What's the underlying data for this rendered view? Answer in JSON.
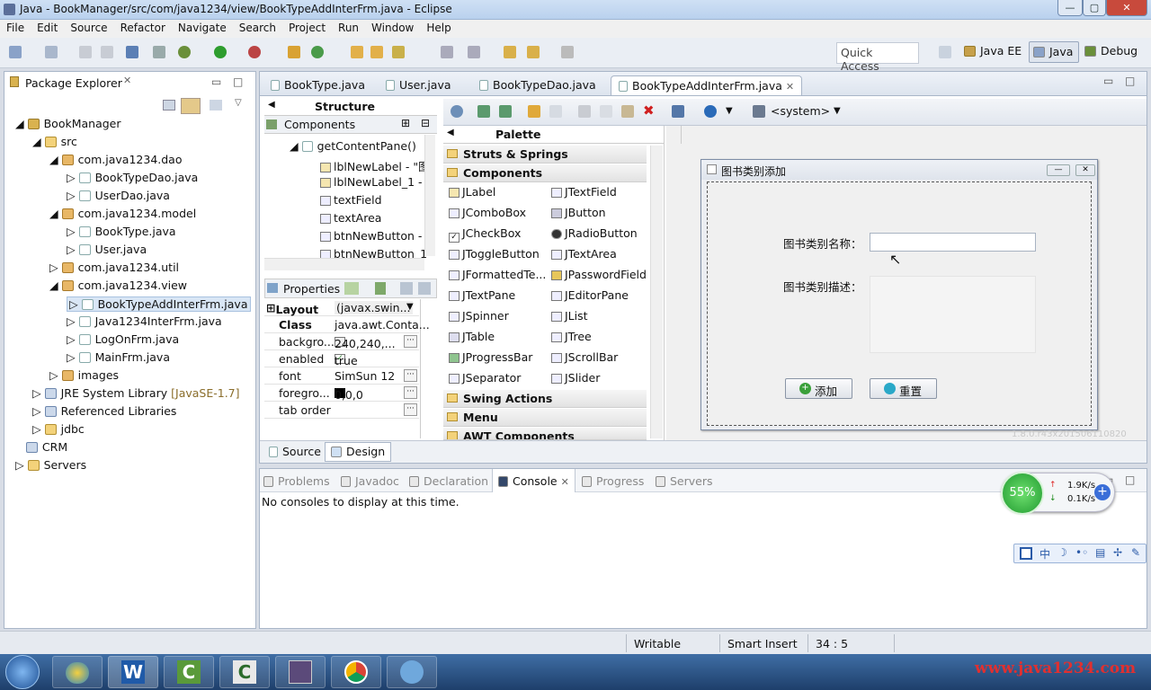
{
  "window": {
    "title": "Java - BookManager/src/com/java1234/view/BookTypeAddInterFrm.java - Eclipse",
    "min": "—",
    "max": "▢",
    "close": "✕"
  },
  "menu": [
    "File",
    "Edit",
    "Source",
    "Refactor",
    "Navigate",
    "Search",
    "Project",
    "Run",
    "Window",
    "Help"
  ],
  "quick_access": "Quick Access",
  "perspectives": [
    "Java EE",
    "Java",
    "Debug"
  ],
  "package_explorer": {
    "title": "Package Explorer",
    "tree": [
      {
        "label": "BookManager",
        "icon": "project-icon"
      },
      {
        "label": "src",
        "icon": "folder-icon"
      },
      {
        "label": "com.java1234.dao",
        "icon": "package-icon"
      },
      {
        "label": "BookTypeDao.java",
        "icon": "java-file-icon"
      },
      {
        "label": "UserDao.java",
        "icon": "java-file-icon"
      },
      {
        "label": "com.java1234.model",
        "icon": "package-icon"
      },
      {
        "label": "BookType.java",
        "icon": "java-file-icon"
      },
      {
        "label": "User.java",
        "icon": "java-file-icon"
      },
      {
        "label": "com.java1234.util",
        "icon": "package-icon"
      },
      {
        "label": "com.java1234.view",
        "icon": "package-icon"
      },
      {
        "label": "BookTypeAddInterFrm.java",
        "icon": "java-file-icon"
      },
      {
        "label": "Java1234InterFrm.java",
        "icon": "java-file-icon"
      },
      {
        "label": "LogOnFrm.java",
        "icon": "java-file-icon"
      },
      {
        "label": "MainFrm.java",
        "icon": "java-file-icon"
      },
      {
        "label": "images",
        "icon": "package-icon"
      },
      {
        "label": "JRE System Library",
        "icon": "library-icon",
        "suffix": "[JavaSE-1.7]"
      },
      {
        "label": "Referenced Libraries",
        "icon": "library-icon"
      },
      {
        "label": "jdbc",
        "icon": "folder-icon"
      },
      {
        "label": "CRM",
        "icon": "project-icon"
      },
      {
        "label": "Servers",
        "icon": "folder-icon"
      }
    ]
  },
  "editor_tabs": [
    "BookType.java",
    "User.java",
    "BookTypeDao.java",
    "BookTypeAddInterFrm.java"
  ],
  "structure": {
    "title": "Structure",
    "components_label": "Components",
    "items": [
      "getContentPane()",
      "lblNewLabel - \"图",
      "lblNewLabel_1 -",
      "textField",
      "textArea",
      "btnNewButton -",
      "btnNewButton_1"
    ]
  },
  "properties": {
    "title": "Properties",
    "rows": [
      {
        "name": "Layout",
        "value": "(javax.swin..."
      },
      {
        "name": "Class",
        "value": "java.awt.Conta..."
      },
      {
        "name": "backgro...",
        "value": "240,240,..."
      },
      {
        "name": "enabled",
        "value": "true"
      },
      {
        "name": "font",
        "value": "SimSun 12"
      },
      {
        "name": "foregro...",
        "value": "0,0,0"
      },
      {
        "name": "tab order",
        "value": ""
      }
    ]
  },
  "palette": {
    "title": "Palette",
    "categories": [
      "Struts & Springs",
      "Components",
      "Swing Actions",
      "Menu",
      "AWT Components"
    ],
    "components": [
      "JLabel",
      "JTextField",
      "JComboBox",
      "JButton",
      "JCheckBox",
      "JRadioButton",
      "JToggleButton",
      "JTextArea",
      "JFormattedTe...",
      "JPasswordField",
      "JTextPane",
      "JEditorPane",
      "JSpinner",
      "JList",
      "JTable",
      "JTree",
      "JProgressBar",
      "JScrollBar",
      "JSeparator",
      "JSlider"
    ]
  },
  "design_toolbar": {
    "system": "<system>"
  },
  "form": {
    "title": "图书类别添加",
    "name_label": "图书类别名称：",
    "desc_label": "图书类别描述：",
    "add_button": "添加",
    "reset_button": "重置"
  },
  "version_text": "1.8.0.r43x201506110820",
  "bottom_tabs": {
    "source": "Source",
    "design": "Design"
  },
  "console": {
    "tabs": [
      "Problems",
      "Javadoc",
      "Declaration",
      "Console",
      "Progress",
      "Servers"
    ],
    "message": "No consoles to display at this time."
  },
  "net_widget": {
    "percent": "55%",
    "up": "1.9K/s",
    "down": "0.1K/s"
  },
  "ime_bar": [
    "中"
  ],
  "status": {
    "writable": "Writable",
    "insert": "Smart Insert",
    "position": "34 : 5"
  },
  "watermark": "www.java1234.com",
  "taskbar_apps": [
    "start-orb",
    "w-app",
    "camtasia-app",
    "camtasia-recorder-app",
    "java-app",
    "chrome-app",
    "media-app"
  ]
}
